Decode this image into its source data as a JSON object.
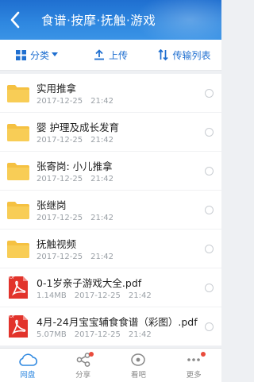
{
  "header": {
    "title": "食谱·按摩·抚触·游戏"
  },
  "toolbar": {
    "sort": "分类",
    "upload": "上传",
    "transfer": "传输列表"
  },
  "files": [
    {
      "type": "folder",
      "name": "实用推拿",
      "size": "",
      "date": "2017-12-25",
      "time": "21:42"
    },
    {
      "type": "folder",
      "name": "婴 护理及成长发育",
      "size": "",
      "date": "2017-12-25",
      "time": "21:42"
    },
    {
      "type": "folder",
      "name": "张寄岗: 小儿推拿",
      "size": "",
      "date": "2017-12-25",
      "time": "21:42"
    },
    {
      "type": "folder",
      "name": "张继岗",
      "size": "",
      "date": "2017-12-25",
      "time": "21:42"
    },
    {
      "type": "folder",
      "name": "抚触视频",
      "size": "",
      "date": "2017-12-25",
      "time": "21:42"
    },
    {
      "type": "pdf",
      "name": "0-1岁亲子游戏大全.pdf",
      "size": "1.14MB",
      "date": "2017-12-25",
      "time": "21:42",
      "badge": "PDF"
    },
    {
      "type": "pdf",
      "name": "4月-24月宝宝辅食食谱（彩图）.pdf",
      "size": "5.07MB",
      "date": "2017-12-25",
      "time": "21:42",
      "badge": "PDF"
    }
  ],
  "tabs": [
    {
      "label": "网盘",
      "icon": "cloud-icon",
      "active": true
    },
    {
      "label": "分享",
      "icon": "share-icon"
    },
    {
      "label": "看吧",
      "icon": "eye-icon"
    },
    {
      "label": "更多",
      "icon": "more-icon"
    }
  ],
  "colors": {
    "accent": "#2f88e0",
    "folder": "#f5c142",
    "pdf": "#e2332b",
    "badge": "#e94b3c"
  }
}
